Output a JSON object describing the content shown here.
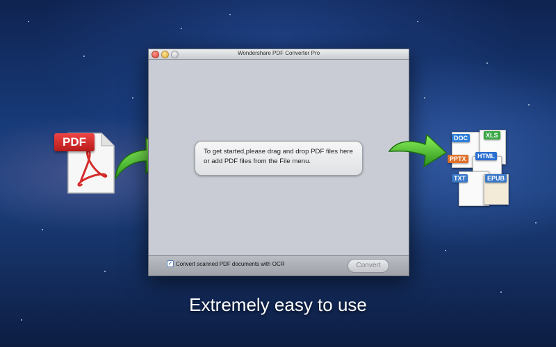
{
  "window": {
    "title": "Wondershare PDF Converter Pro",
    "hint": "To get started,please drag and drop PDF files here or add PDF files from the File menu.",
    "ocr_label": "Convert scanned PDF documents with OCR",
    "ocr_checked": true,
    "convert_label": "Convert"
  },
  "left_icon": {
    "tag": "PDF"
  },
  "formats": [
    "DOC",
    "XLS",
    "PPTX",
    "HTML",
    "TXT",
    "EPUB"
  ],
  "tagline": "Extremely easy to use",
  "colors": {
    "pdf_red": "#d42a2a",
    "arrow_green": "#3fbf2a",
    "window_bg": "#c9ccd4"
  }
}
